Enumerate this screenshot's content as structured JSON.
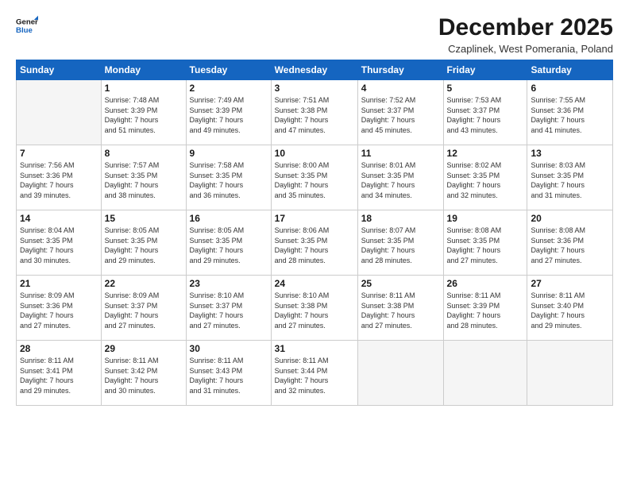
{
  "logo": {
    "line1": "General",
    "line2": "Blue"
  },
  "title": "December 2025",
  "subtitle": "Czaplinek, West Pomerania, Poland",
  "weekdays": [
    "Sunday",
    "Monday",
    "Tuesday",
    "Wednesday",
    "Thursday",
    "Friday",
    "Saturday"
  ],
  "weeks": [
    [
      {
        "day": "",
        "info": ""
      },
      {
        "day": "1",
        "info": "Sunrise: 7:48 AM\nSunset: 3:39 PM\nDaylight: 7 hours\nand 51 minutes."
      },
      {
        "day": "2",
        "info": "Sunrise: 7:49 AM\nSunset: 3:39 PM\nDaylight: 7 hours\nand 49 minutes."
      },
      {
        "day": "3",
        "info": "Sunrise: 7:51 AM\nSunset: 3:38 PM\nDaylight: 7 hours\nand 47 minutes."
      },
      {
        "day": "4",
        "info": "Sunrise: 7:52 AM\nSunset: 3:37 PM\nDaylight: 7 hours\nand 45 minutes."
      },
      {
        "day": "5",
        "info": "Sunrise: 7:53 AM\nSunset: 3:37 PM\nDaylight: 7 hours\nand 43 minutes."
      },
      {
        "day": "6",
        "info": "Sunrise: 7:55 AM\nSunset: 3:36 PM\nDaylight: 7 hours\nand 41 minutes."
      }
    ],
    [
      {
        "day": "7",
        "info": "Sunrise: 7:56 AM\nSunset: 3:36 PM\nDaylight: 7 hours\nand 39 minutes."
      },
      {
        "day": "8",
        "info": "Sunrise: 7:57 AM\nSunset: 3:35 PM\nDaylight: 7 hours\nand 38 minutes."
      },
      {
        "day": "9",
        "info": "Sunrise: 7:58 AM\nSunset: 3:35 PM\nDaylight: 7 hours\nand 36 minutes."
      },
      {
        "day": "10",
        "info": "Sunrise: 8:00 AM\nSunset: 3:35 PM\nDaylight: 7 hours\nand 35 minutes."
      },
      {
        "day": "11",
        "info": "Sunrise: 8:01 AM\nSunset: 3:35 PM\nDaylight: 7 hours\nand 34 minutes."
      },
      {
        "day": "12",
        "info": "Sunrise: 8:02 AM\nSunset: 3:35 PM\nDaylight: 7 hours\nand 32 minutes."
      },
      {
        "day": "13",
        "info": "Sunrise: 8:03 AM\nSunset: 3:35 PM\nDaylight: 7 hours\nand 31 minutes."
      }
    ],
    [
      {
        "day": "14",
        "info": "Sunrise: 8:04 AM\nSunset: 3:35 PM\nDaylight: 7 hours\nand 30 minutes."
      },
      {
        "day": "15",
        "info": "Sunrise: 8:05 AM\nSunset: 3:35 PM\nDaylight: 7 hours\nand 29 minutes."
      },
      {
        "day": "16",
        "info": "Sunrise: 8:05 AM\nSunset: 3:35 PM\nDaylight: 7 hours\nand 29 minutes."
      },
      {
        "day": "17",
        "info": "Sunrise: 8:06 AM\nSunset: 3:35 PM\nDaylight: 7 hours\nand 28 minutes."
      },
      {
        "day": "18",
        "info": "Sunrise: 8:07 AM\nSunset: 3:35 PM\nDaylight: 7 hours\nand 28 minutes."
      },
      {
        "day": "19",
        "info": "Sunrise: 8:08 AM\nSunset: 3:35 PM\nDaylight: 7 hours\nand 27 minutes."
      },
      {
        "day": "20",
        "info": "Sunrise: 8:08 AM\nSunset: 3:36 PM\nDaylight: 7 hours\nand 27 minutes."
      }
    ],
    [
      {
        "day": "21",
        "info": "Sunrise: 8:09 AM\nSunset: 3:36 PM\nDaylight: 7 hours\nand 27 minutes."
      },
      {
        "day": "22",
        "info": "Sunrise: 8:09 AM\nSunset: 3:37 PM\nDaylight: 7 hours\nand 27 minutes."
      },
      {
        "day": "23",
        "info": "Sunrise: 8:10 AM\nSunset: 3:37 PM\nDaylight: 7 hours\nand 27 minutes."
      },
      {
        "day": "24",
        "info": "Sunrise: 8:10 AM\nSunset: 3:38 PM\nDaylight: 7 hours\nand 27 minutes."
      },
      {
        "day": "25",
        "info": "Sunrise: 8:11 AM\nSunset: 3:38 PM\nDaylight: 7 hours\nand 27 minutes."
      },
      {
        "day": "26",
        "info": "Sunrise: 8:11 AM\nSunset: 3:39 PM\nDaylight: 7 hours\nand 28 minutes."
      },
      {
        "day": "27",
        "info": "Sunrise: 8:11 AM\nSunset: 3:40 PM\nDaylight: 7 hours\nand 29 minutes."
      }
    ],
    [
      {
        "day": "28",
        "info": "Sunrise: 8:11 AM\nSunset: 3:41 PM\nDaylight: 7 hours\nand 29 minutes."
      },
      {
        "day": "29",
        "info": "Sunrise: 8:11 AM\nSunset: 3:42 PM\nDaylight: 7 hours\nand 30 minutes."
      },
      {
        "day": "30",
        "info": "Sunrise: 8:11 AM\nSunset: 3:43 PM\nDaylight: 7 hours\nand 31 minutes."
      },
      {
        "day": "31",
        "info": "Sunrise: 8:11 AM\nSunset: 3:44 PM\nDaylight: 7 hours\nand 32 minutes."
      },
      {
        "day": "",
        "info": ""
      },
      {
        "day": "",
        "info": ""
      },
      {
        "day": "",
        "info": ""
      }
    ]
  ]
}
